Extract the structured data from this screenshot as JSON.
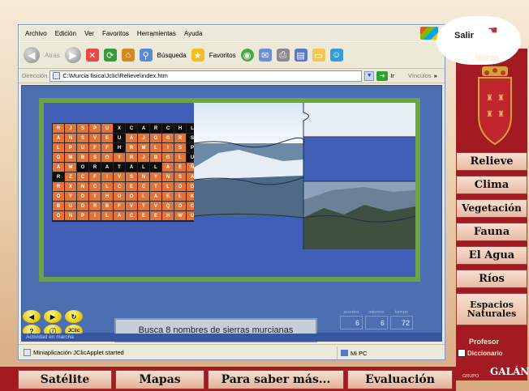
{
  "browser": {
    "menu": [
      "Archivo",
      "Edición",
      "Ver",
      "Favoritos",
      "Herramientas",
      "Ayuda"
    ],
    "toolbar": {
      "back": "Atrás",
      "search": "Búsqueda",
      "favorites": "Favoritos"
    },
    "address": {
      "label": "Dirección",
      "url": "C:\\Murcia fisica\\Jclic\\Relieve\\index.htm",
      "go": "Ir",
      "links": "Vínculos"
    },
    "inner_status": "Actividad en marcha",
    "status_left": "Miniaplicación JClicApplet started",
    "status_right": "Mi PC"
  },
  "activity": {
    "grid_rows": [
      [
        "R",
        "J",
        "S",
        "P",
        "U",
        "X",
        "C",
        "A",
        "R",
        "C",
        "H",
        "L"
      ],
      [
        "A",
        "N",
        "S",
        "V",
        "E",
        "U",
        "A",
        "J",
        "G",
        "G",
        "R",
        "S"
      ],
      [
        "L",
        "P",
        "U",
        "F",
        "F",
        "H",
        "R",
        "M",
        "L",
        "I",
        "S",
        "P"
      ],
      [
        "G",
        "M",
        "B",
        "S",
        "O",
        "Y",
        "R",
        "J",
        "B",
        "G",
        "L",
        "U"
      ],
      [
        "A",
        "M",
        "O",
        "R",
        "A",
        "T",
        "A",
        "L",
        "L",
        "A",
        "E",
        "Ñ"
      ],
      [
        "R",
        "Z",
        "C",
        "F",
        "I",
        "V",
        "S",
        "N",
        "Y",
        "N",
        "S",
        "A"
      ],
      [
        "R",
        "X",
        "N",
        "C",
        "L",
        "C",
        "E",
        "C",
        "T",
        "L",
        "O",
        "O"
      ],
      [
        "O",
        "Y",
        "D",
        "Y",
        "H",
        "U",
        "O",
        "L",
        "A",
        "E",
        "L",
        "K"
      ],
      [
        "B",
        "U",
        "D",
        "R",
        "B",
        "F",
        "V",
        "T",
        "V",
        "Q",
        "O",
        "C"
      ],
      [
        "O",
        "N",
        "P",
        "I",
        "L",
        "A",
        "C",
        "E",
        "E",
        "H",
        "W",
        "U"
      ]
    ],
    "controls": [
      "◀",
      "▶",
      "↻",
      "?",
      "ⓘ",
      "JClic"
    ],
    "message": "Busca 8 nombres de sierras murcianas",
    "counters": [
      {
        "label": "aciertos",
        "value": "6"
      },
      {
        "label": "intentos",
        "value": "6"
      },
      {
        "label": "tiempo",
        "value": "72"
      }
    ]
  },
  "sidebar": {
    "salir": "Salir",
    "inicio": "Inicio",
    "items": [
      "Relieve",
      "Clima",
      "Vegetación",
      "Fauna",
      "El Agua",
      "Ríos",
      "Espacios Naturales"
    ],
    "profesor": "Profesor",
    "diccionario": "Diccionario",
    "grupo": "GRUPO",
    "galan": "GALÁN"
  },
  "bottom_nav": [
    "Satélite",
    "Mapas",
    "Para saber más...",
    "Evaluación"
  ]
}
